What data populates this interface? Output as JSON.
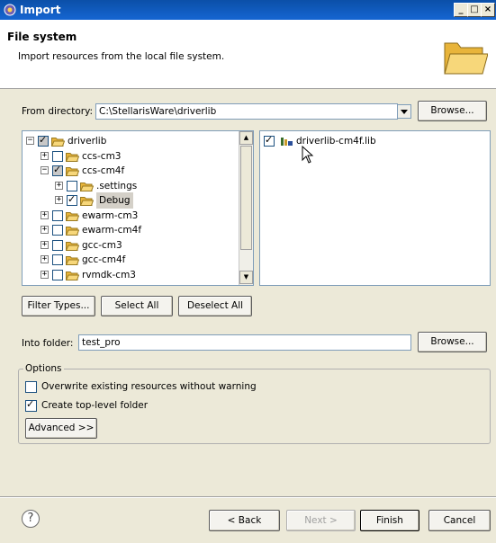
{
  "window": {
    "title": "Import",
    "controls": [
      "_",
      "□",
      "×"
    ]
  },
  "header": {
    "title": "File system",
    "description": "Import resources from the local file system."
  },
  "from_directory": {
    "label": "From directory:",
    "value": "C:\\StellarisWare\\driverlib",
    "browse": "Browse..."
  },
  "tree": {
    "items": [
      {
        "label": "driverlib",
        "expander": "−",
        "checked": "partial"
      },
      {
        "label": "ccs-cm3",
        "expander": "+",
        "checked": "none"
      },
      {
        "label": "ccs-cm4f",
        "expander": "−",
        "checked": "partial"
      },
      {
        "label": ".settings",
        "expander": "+",
        "checked": "none"
      },
      {
        "label": "Debug",
        "expander": "+",
        "checked": "full"
      },
      {
        "label": "ewarm-cm3",
        "expander": "+",
        "checked": "none"
      },
      {
        "label": "ewarm-cm4f",
        "expander": "+",
        "checked": "none"
      },
      {
        "label": "gcc-cm3",
        "expander": "+",
        "checked": "none"
      },
      {
        "label": "gcc-cm4f",
        "expander": "+",
        "checked": "none"
      },
      {
        "label": "rvmdk-cm3",
        "expander": "+",
        "checked": "none"
      }
    ]
  },
  "files": {
    "items": [
      {
        "label": "driverlib-cm4f.lib",
        "checked": true
      }
    ]
  },
  "filter_buttons": {
    "filter_types": "Filter Types...",
    "select_all": "Select All",
    "deselect_all": "Deselect All"
  },
  "into_folder": {
    "label": "Into folder:",
    "value": "test_pro",
    "browse": "Browse..."
  },
  "options": {
    "title": "Options",
    "overwrite": {
      "label": "Overwrite existing resources without warning",
      "checked": false
    },
    "create_top": {
      "label": "Create top-level folder",
      "checked": true
    },
    "advanced": "Advanced >>"
  },
  "footer": {
    "help": "?",
    "back": "< Back",
    "next": "Next >",
    "finish": "Finish",
    "cancel": "Cancel"
  },
  "colors": {
    "title_bar": "#0b4fa8",
    "dialog_bg": "#ece9d8",
    "folder_yellow": "#f5c542",
    "selection": "#d4d0c8"
  }
}
